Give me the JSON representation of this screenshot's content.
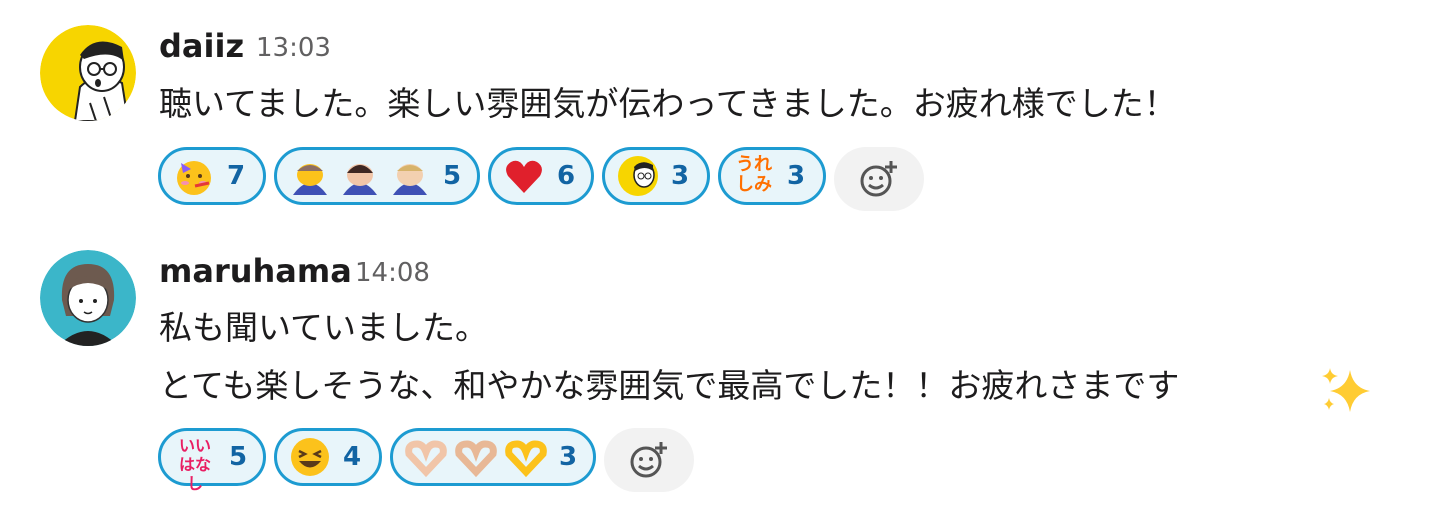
{
  "messages": [
    {
      "user": "daiiz",
      "time": "13:03",
      "lines": [
        "聴いてました。楽しい雰囲気が伝わってきました。お疲れ様でした！"
      ],
      "reactions": [
        {
          "emoji": "partying-face",
          "count": "7"
        },
        {
          "emoji": "bowing-persons",
          "count": "5"
        },
        {
          "emoji": "red-heart",
          "count": "6"
        },
        {
          "emoji": "daiiz-face",
          "count": "3"
        },
        {
          "emoji": "ureshimi",
          "text": "うれしみ",
          "count": "3"
        }
      ]
    },
    {
      "user": "maruhama",
      "time": "14:08",
      "lines": [
        "私も聞いていました。",
        "とても楽しそうな、和やかな雰囲気で最高でした！！お疲れさまです"
      ],
      "reactions": [
        {
          "emoji": "iihanashi",
          "text": "いいはなし",
          "count": "5"
        },
        {
          "emoji": "laughing-face",
          "count": "4"
        },
        {
          "emoji": "heart-hands",
          "count": "3"
        }
      ]
    }
  ],
  "colors": {
    "accent": "#1d9bd1",
    "pill_bg": "#e8f5fa",
    "count": "#1264a3",
    "avatar1": "#f7d500",
    "avatar2": "#3bb6c9"
  }
}
